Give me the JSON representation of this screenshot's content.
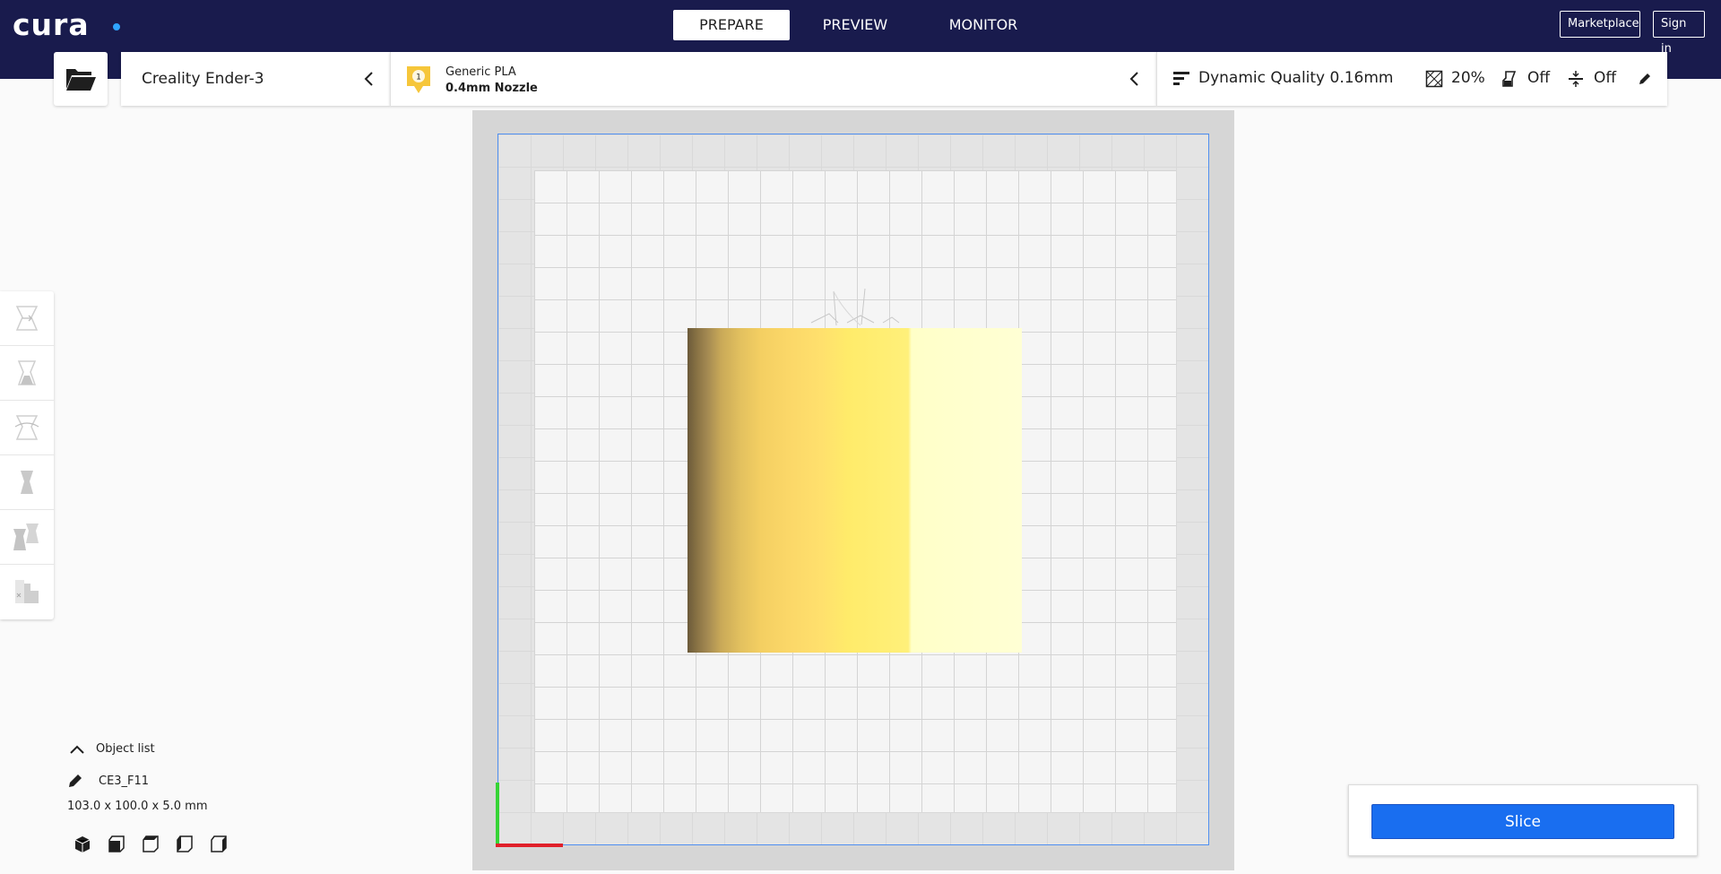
{
  "header": {
    "logo_text": "cura",
    "tabs": [
      {
        "label": "PREPARE",
        "active": true
      },
      {
        "label": "PREVIEW",
        "active": false
      },
      {
        "label": "MONITOR",
        "active": false
      }
    ],
    "marketplace_label": "Marketplace",
    "signin_label": "Sign in"
  },
  "printer": {
    "name": "Creality Ender-3"
  },
  "material": {
    "extruder_number": "1",
    "name": "Generic PLA",
    "nozzle": "0.4mm Nozzle"
  },
  "print_settings": {
    "profile": "Dynamic Quality 0.16mm",
    "infill": "20%",
    "support": "Off",
    "adhesion": "Off"
  },
  "object_list": {
    "label": "Object list",
    "object_name": "CE3_F11",
    "dimensions": "103.0 x 100.0 x 5.0 mm"
  },
  "slice": {
    "label": "Slice"
  },
  "colors": {
    "header_bg": "#191b4d",
    "accent": "#196ef0"
  }
}
